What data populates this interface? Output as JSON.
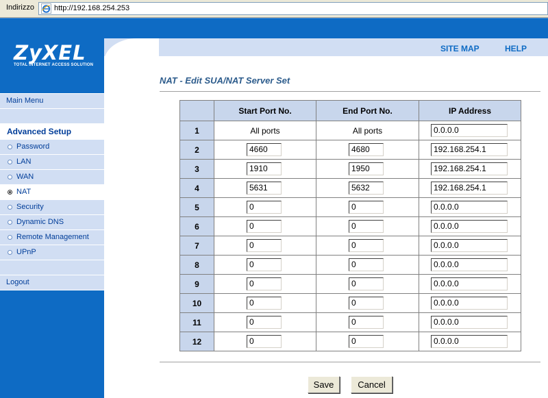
{
  "browser": {
    "address_label": "Indirizzo",
    "url": "http://192.168.254.253"
  },
  "logo": {
    "name": "ZyXEL",
    "tagline": "Total Internet Access Solution"
  },
  "header_links": {
    "site_map": "SITE MAP",
    "help": "HELP"
  },
  "sidebar": {
    "main_menu": "Main Menu",
    "section": "Advanced Setup",
    "items": [
      "Password",
      "LAN",
      "WAN",
      "NAT",
      "Security",
      "Dynamic DNS",
      "Remote Management",
      "UPnP"
    ],
    "active_item": "NAT",
    "logout": "Logout"
  },
  "page": {
    "title": "NAT - Edit SUA/NAT Server Set"
  },
  "table": {
    "headers": [
      "",
      "Start Port No.",
      "End Port No.",
      "IP Address"
    ],
    "rows": [
      {
        "index": "1",
        "start": "All ports",
        "end": "All ports",
        "ip": "0.0.0.0"
      },
      {
        "index": "2",
        "start": "4660",
        "end": "4680",
        "ip": "192.168.254.1"
      },
      {
        "index": "3",
        "start": "1910",
        "end": "1950",
        "ip": "192.168.254.1"
      },
      {
        "index": "4",
        "start": "5631",
        "end": "5632",
        "ip": "192.168.254.1"
      },
      {
        "index": "5",
        "start": "0",
        "end": "0",
        "ip": "0.0.0.0"
      },
      {
        "index": "6",
        "start": "0",
        "end": "0",
        "ip": "0.0.0.0"
      },
      {
        "index": "7",
        "start": "0",
        "end": "0",
        "ip": "0.0.0.0"
      },
      {
        "index": "8",
        "start": "0",
        "end": "0",
        "ip": "0.0.0.0"
      },
      {
        "index": "9",
        "start": "0",
        "end": "0",
        "ip": "0.0.0.0"
      },
      {
        "index": "10",
        "start": "0",
        "end": "0",
        "ip": "0.0.0.0"
      },
      {
        "index": "11",
        "start": "0",
        "end": "0",
        "ip": "0.0.0.0"
      },
      {
        "index": "12",
        "start": "0",
        "end": "0",
        "ip": "0.0.0.0"
      }
    ]
  },
  "buttons": {
    "save": "Save",
    "cancel": "Cancel"
  }
}
